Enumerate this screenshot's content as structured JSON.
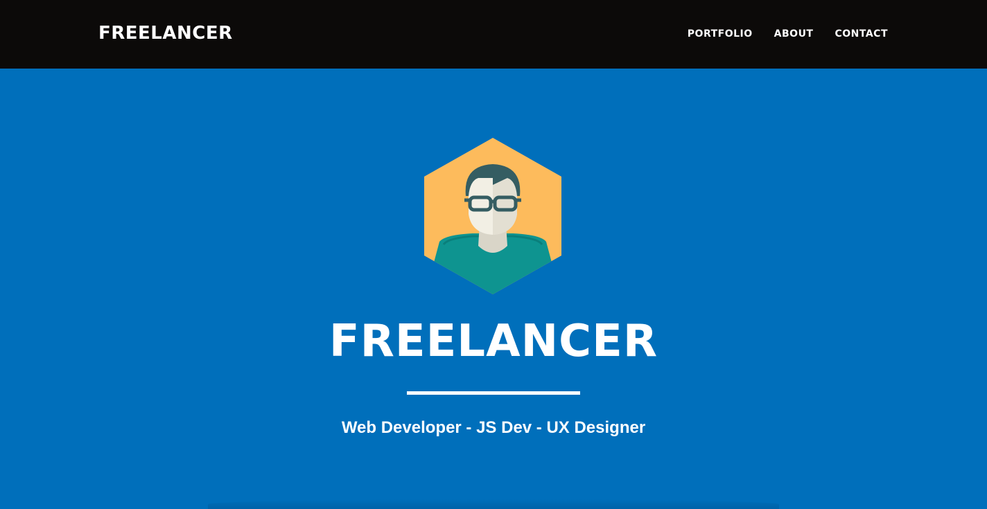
{
  "navbar": {
    "brand": "FREELANCER",
    "links": [
      "PORTFOLIO",
      "ABOUT",
      "CONTACT"
    ]
  },
  "hero": {
    "avatar_icon": "user-avatar-icon",
    "title": "FREELANCER",
    "subtitle": "Web Developer - JS Dev - UX Designer"
  },
  "colors": {
    "navbar_bg": "#0c0a09",
    "hero_bg": "#006fbb",
    "hexagon": "#fdbb5c",
    "shirt": "#0e9490",
    "hair": "#355d62",
    "skin": "#f2efe4",
    "text": "#ffffff"
  }
}
